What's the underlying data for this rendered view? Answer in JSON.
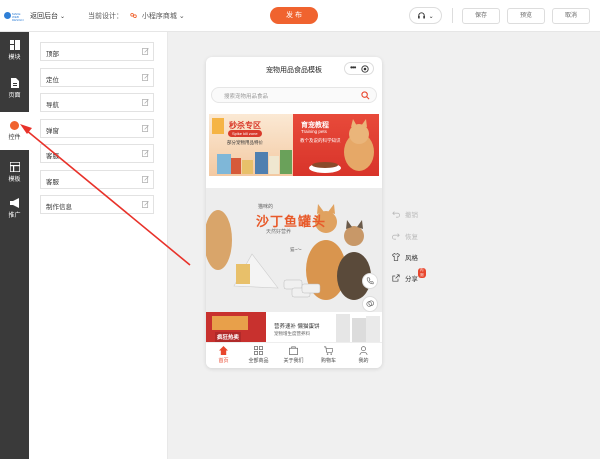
{
  "header": {
    "brand_text": "MAKE WEB DESIGN",
    "back_label": "返回后台",
    "current_design_label": "当前设计：",
    "current_design_value": "小程序商城",
    "publish_label": "发 布",
    "save_label": "保存",
    "preview_label": "预览",
    "cancel_label": "取消"
  },
  "rail": [
    {
      "label": "模块",
      "icon": "module-icon"
    },
    {
      "label": "页面",
      "icon": "page-icon"
    },
    {
      "label": "控件",
      "icon": "widget-icon"
    },
    {
      "label": "模板",
      "icon": "template-icon"
    },
    {
      "label": "推广",
      "icon": "promote-icon"
    }
  ],
  "components": [
    "顶部",
    "定位",
    "导航",
    "弹窗",
    "客服",
    "客服",
    "制作信息"
  ],
  "phone": {
    "title": "宠物用品食品模板",
    "search_placeholder": "搜索宠物用品食品",
    "promo_left": {
      "title": "秒杀专区",
      "subtitle": "Spike kill zone",
      "desc": "部分宠物用品特价"
    },
    "promo_right": {
      "title": "育宠教程",
      "subtitle": "Training pets",
      "desc": "教个及说的科学知识"
    },
    "banner": {
      "line1": "猫咪的",
      "line2": "沙丁鱼罐头",
      "line3": "天然好营养",
      "tag": "猫~～"
    },
    "bottom_promo": {
      "title": "营养速补 懒猫蛋饼",
      "subtitle": "宠物增生度营养料",
      "sale": "疯狂热卖"
    },
    "nav": [
      "首页",
      "全部商品",
      "关于我们",
      "购物车",
      "我的"
    ]
  },
  "actions": {
    "undo": "撤销",
    "redo": "恢复",
    "style": "风格",
    "share": "分享",
    "share_badge": "内测"
  },
  "colors": {
    "accent": "#f0632f",
    "rail_bg": "#3a3a3a",
    "nav_active": "#e8462d"
  }
}
